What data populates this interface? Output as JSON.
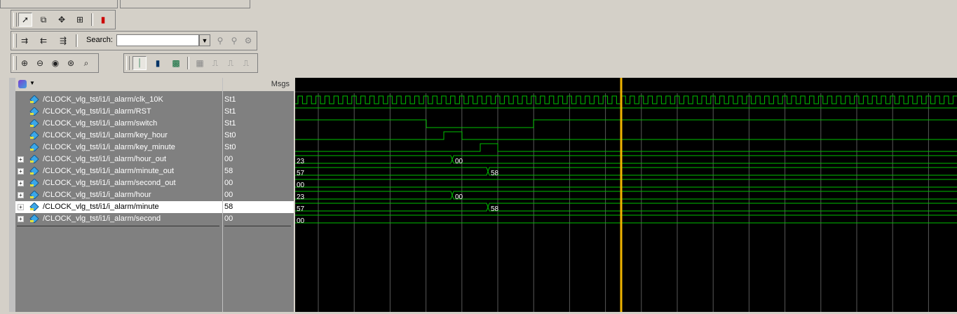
{
  "search": {
    "label": "Search:",
    "value": ""
  },
  "columns": {
    "msgs": "Msgs"
  },
  "signals": [
    {
      "name": "/CLOCK_vlg_tst/i1/i_alarm/clk_10K",
      "value": "St1",
      "bus": false
    },
    {
      "name": "/CLOCK_vlg_tst/i1/i_alarm/RST",
      "value": "St1",
      "bus": false
    },
    {
      "name": "/CLOCK_vlg_tst/i1/i_alarm/switch",
      "value": "St1",
      "bus": false
    },
    {
      "name": "/CLOCK_vlg_tst/i1/i_alarm/key_hour",
      "value": "St0",
      "bus": false
    },
    {
      "name": "/CLOCK_vlg_tst/i1/i_alarm/key_minute",
      "value": "St0",
      "bus": false
    },
    {
      "name": "/CLOCK_vlg_tst/i1/i_alarm/hour_out",
      "value": "00",
      "bus": true
    },
    {
      "name": "/CLOCK_vlg_tst/i1/i_alarm/minute_out",
      "value": "58",
      "bus": true
    },
    {
      "name": "/CLOCK_vlg_tst/i1/i_alarm/second_out",
      "value": "00",
      "bus": true
    },
    {
      "name": "/CLOCK_vlg_tst/i1/i_alarm/hour",
      "value": "00",
      "bus": true
    },
    {
      "name": "/CLOCK_vlg_tst/i1/i_alarm/minute",
      "value": "58",
      "bus": true,
      "selected": true
    },
    {
      "name": "/CLOCK_vlg_tst/i1/i_alarm/second",
      "value": "00",
      "bus": true
    }
  ],
  "bus_waves": {
    "hour_out": {
      "before": "23",
      "after": "00"
    },
    "minute_out": {
      "before": "57",
      "after": "58"
    },
    "second_out": {
      "value": "00"
    },
    "hour": {
      "before": "23",
      "after": "00"
    },
    "minute": {
      "before": "57",
      "after": "58"
    },
    "second": {
      "value": "00"
    }
  },
  "colors": {
    "wave": "#00c000",
    "cursor": "#f0b400",
    "grid": "#585858",
    "selected_row": "#ffffff"
  }
}
